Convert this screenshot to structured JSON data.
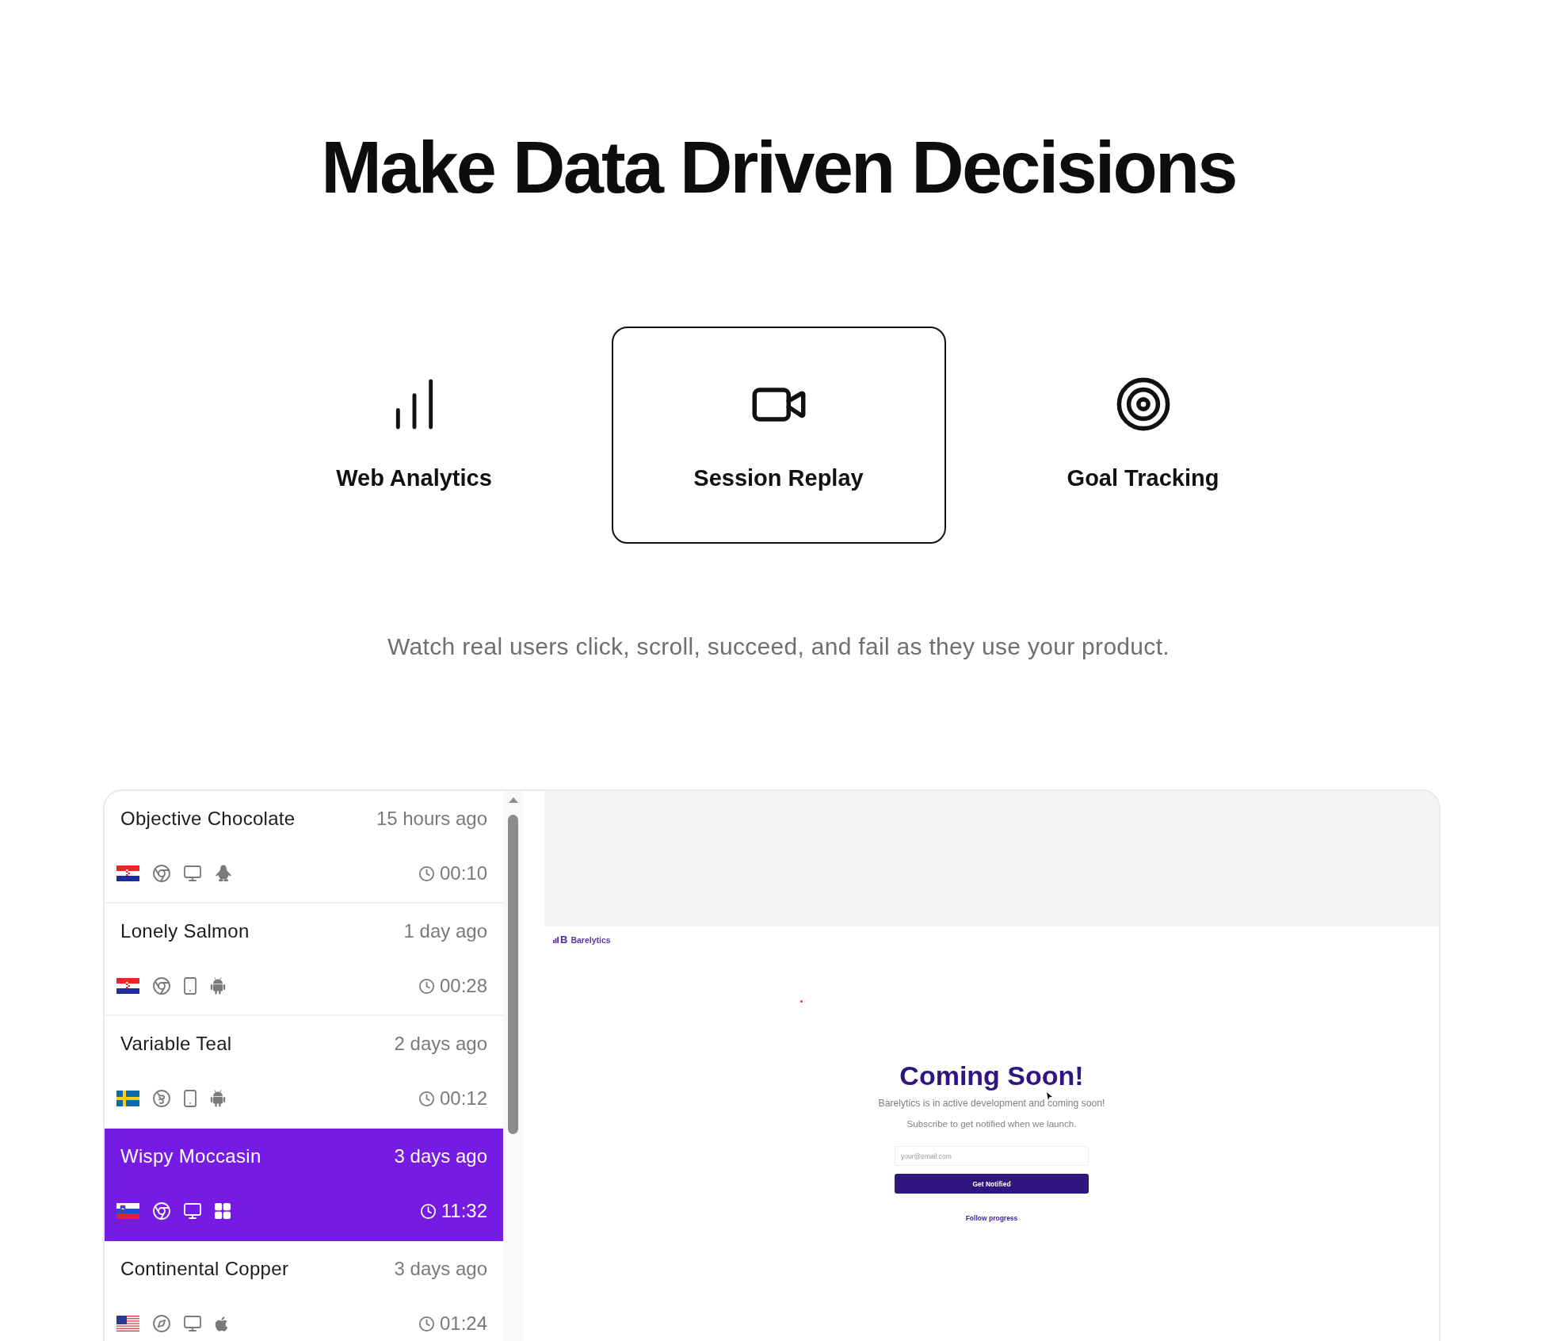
{
  "heading": "Make Data Driven Decisions",
  "features": [
    {
      "kind": "analytics",
      "label": "Web Analytics",
      "selected": false
    },
    {
      "kind": "replay",
      "label": "Session Replay",
      "selected": true
    },
    {
      "kind": "goals",
      "label": "Goal Tracking",
      "selected": false
    }
  ],
  "description": "Watch real users click, scroll, succeed, and fail as they use your product.",
  "sessions": [
    {
      "name": "Objective Chocolate",
      "time": "15 hours ago",
      "icons": [
        {
          "kind": "croatia"
        },
        {
          "kind": "chrome"
        },
        {
          "kind": "desktop"
        },
        {
          "kind": "linux"
        }
      ],
      "duration": "00:10",
      "selected": false
    },
    {
      "name": "Lonely Salmon",
      "time": "1 day ago",
      "icons": [
        {
          "kind": "croatia"
        },
        {
          "kind": "chrome"
        },
        {
          "kind": "phone"
        },
        {
          "kind": "android"
        }
      ],
      "duration": "00:28",
      "selected": false
    },
    {
      "name": "Variable Teal",
      "time": "2 days ago",
      "icons": [
        {
          "kind": "sweden"
        },
        {
          "kind": "swirl"
        },
        {
          "kind": "phone"
        },
        {
          "kind": "android"
        }
      ],
      "duration": "00:12",
      "selected": false
    },
    {
      "name": "Wispy Moccasin",
      "time": "3 days ago",
      "icons": [
        {
          "kind": "slovenia"
        },
        {
          "kind": "chrome"
        },
        {
          "kind": "desktop"
        },
        {
          "kind": "windows"
        }
      ],
      "duration": "11:32",
      "selected": true
    },
    {
      "name": "Continental Copper",
      "time": "3 days ago",
      "icons": [
        {
          "kind": "usa"
        },
        {
          "kind": "compass"
        },
        {
          "kind": "desktop"
        },
        {
          "kind": "apple"
        }
      ],
      "duration": "01:24",
      "selected": false
    }
  ],
  "replay": {
    "logo_mark": "B",
    "logo": "Barelytics",
    "title": "Coming Soon!",
    "lines": [
      "Barelytics is in active development and coming soon!",
      "Subscribe to get notified when we launch."
    ],
    "email": {
      "placeholder": "your@email.com"
    },
    "button": "Get Notified",
    "link": "Follow progress"
  }
}
